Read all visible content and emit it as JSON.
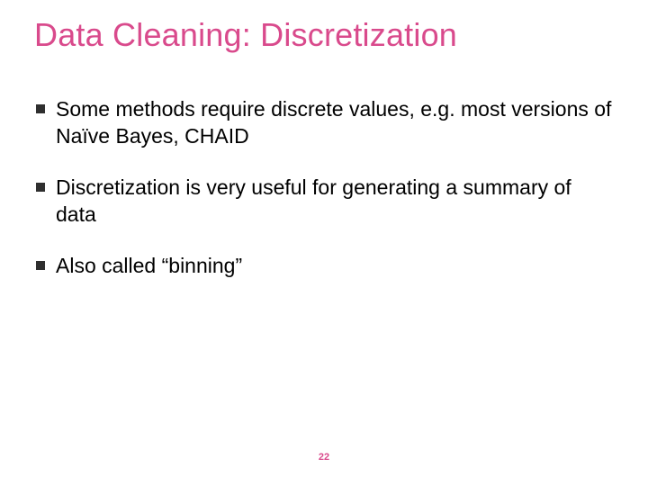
{
  "title": "Data Cleaning: Discretization",
  "bullets": [
    "Some methods require discrete values, e.g. most versions of Naïve Bayes, CHAID",
    "Discretization is very useful for generating a summary of data",
    "Also called “binning”"
  ],
  "page_number": "22"
}
